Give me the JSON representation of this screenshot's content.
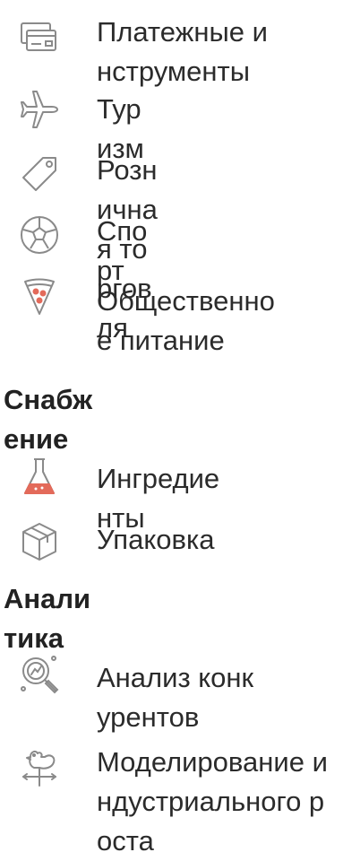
{
  "menu": {
    "items_top": [
      {
        "label": "Платежные инструменты",
        "icon": "credit-card-icon"
      },
      {
        "label": "Туризм",
        "icon": "airplane-icon"
      },
      {
        "label": "Розничная торговля",
        "icon": "price-tag-icon"
      },
      {
        "label": "Спорт",
        "icon": "soccer-ball-icon"
      },
      {
        "label": "Общественное питание",
        "icon": "pizza-slice-icon"
      }
    ],
    "supply": {
      "title": "Снабжение",
      "items": [
        {
          "label": "Ингредиенты",
          "icon": "flask-icon"
        },
        {
          "label": "Упаковка",
          "icon": "box-icon"
        }
      ]
    },
    "analytics": {
      "title": "Аналитика",
      "items": [
        {
          "label": "Анализ конкурентов",
          "icon": "magnifier-chart-icon"
        },
        {
          "label": "Моделирование индустриального роста",
          "icon": "weathervane-icon"
        }
      ]
    }
  },
  "colors": {
    "icon_stroke": "#8a8a8a",
    "text": "#2b2b2b",
    "pizza_accent": "#e36a5a",
    "flask_accent": "#e36a5a"
  }
}
